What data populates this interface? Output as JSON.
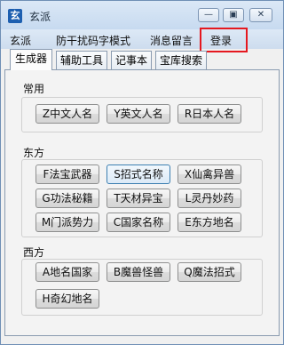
{
  "window": {
    "title": "玄派",
    "app_icon_glyph": "玄",
    "controls": [
      "minimize-icon",
      "maximize-icon",
      "close-icon"
    ]
  },
  "menu": {
    "items": [
      "玄派",
      "防干扰码字模式",
      "消息留言",
      "登录"
    ],
    "highlighted": "登录",
    "highlight_color": "#e5181f"
  },
  "tabs": {
    "items": [
      "生成器",
      "辅助工具",
      "记事本",
      "宝库搜索"
    ],
    "active": "生成器"
  },
  "groups": {
    "names": {
      "label": "常用",
      "buttons": [
        "Z中文人名",
        "Y英文人名",
        "R日本人名"
      ]
    },
    "east": {
      "label": "东方",
      "buttons": [
        "F法宝武器",
        "S招式名称",
        "X仙禽异兽",
        "G功法秘籍",
        "T天材异宝",
        "L灵丹妙药",
        "M门派势力",
        "C国家名称",
        "E东方地名"
      ]
    },
    "west": {
      "label": "西方",
      "buttons": [
        "A地名国家",
        "B魔兽怪兽",
        "Q魔法招式",
        "H奇幻地名"
      ]
    }
  }
}
